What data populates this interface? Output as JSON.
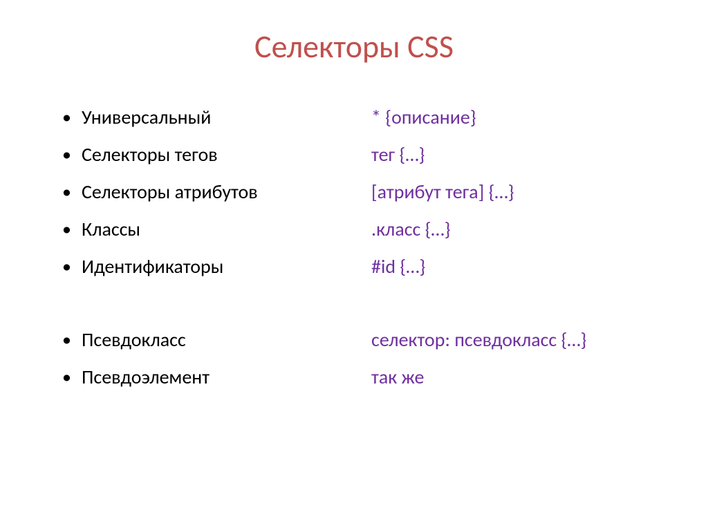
{
  "title": "Селекторы CSS",
  "leftColumn": {
    "group1": [
      "Универсальный",
      "Селекторы тегов",
      "Селекторы атрибутов",
      "Классы",
      "Идентификаторы"
    ],
    "group2": [
      "Псевдокласс",
      "Псевдоэлемент"
    ]
  },
  "rightColumn": {
    "group1": [
      "* {описание}",
      "тег {…}",
      "[атрибут тега] {…}",
      ".класс {…}",
      "#id {…}"
    ],
    "group2": [
      "селектор: псевдокласс {…}",
      "так же"
    ]
  }
}
